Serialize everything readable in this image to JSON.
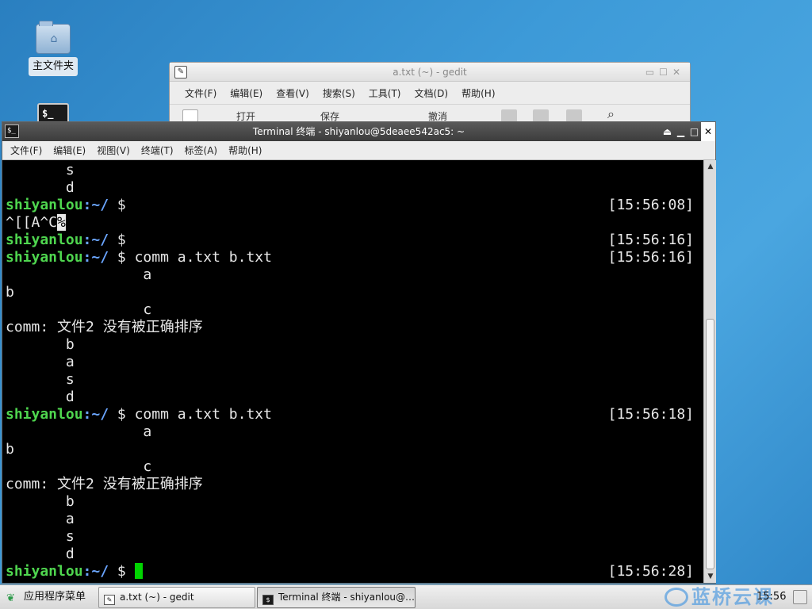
{
  "desktop": {
    "home_folder_label": "主文件夹",
    "terminal_icon_glyph": "$_"
  },
  "gedit": {
    "title": "a.txt (~) - gedit",
    "menu": [
      "文件(F)",
      "编辑(E)",
      "查看(V)",
      "搜索(S)",
      "工具(T)",
      "文档(D)",
      "帮助(H)"
    ],
    "toolbar": {
      "open_label": "打开",
      "save_label": "保存",
      "undo_label": "撤消"
    }
  },
  "terminal": {
    "title": "Terminal 终端 - shiyanlou@5deaee542ac5: ~",
    "menu": [
      "文件(F)",
      "编辑(E)",
      "视图(V)",
      "终端(T)",
      "标签(A)",
      "帮助(H)"
    ],
    "prompt_user": "shiyanlou",
    "prompt_path": ":~/",
    "prompt_symbol": " $",
    "lines": [
      {
        "kind": "out",
        "text": "       s"
      },
      {
        "kind": "out",
        "text": "       d"
      },
      {
        "kind": "prompt",
        "cmd": "",
        "ts": "[15:56:08]"
      },
      {
        "kind": "out_cursor",
        "text": "^[[A^C",
        "highlight": "%"
      },
      {
        "kind": "prompt",
        "cmd": "",
        "ts": "[15:56:16]"
      },
      {
        "kind": "prompt",
        "cmd": " comm a.txt b.txt",
        "ts": "[15:56:16]"
      },
      {
        "kind": "out",
        "text": "                a"
      },
      {
        "kind": "out",
        "text": "b"
      },
      {
        "kind": "out",
        "text": "                c"
      },
      {
        "kind": "out",
        "text": "comm: 文件2 没有被正确排序"
      },
      {
        "kind": "out",
        "text": "       b"
      },
      {
        "kind": "out",
        "text": "       a"
      },
      {
        "kind": "out",
        "text": "       s"
      },
      {
        "kind": "out",
        "text": "       d"
      },
      {
        "kind": "prompt",
        "cmd": " comm a.txt b.txt",
        "ts": "[15:56:18]"
      },
      {
        "kind": "out",
        "text": "                a"
      },
      {
        "kind": "out",
        "text": "b"
      },
      {
        "kind": "out",
        "text": "                c"
      },
      {
        "kind": "out",
        "text": "comm: 文件2 没有被正确排序"
      },
      {
        "kind": "out",
        "text": "       b"
      },
      {
        "kind": "out",
        "text": "       a"
      },
      {
        "kind": "out",
        "text": "       s"
      },
      {
        "kind": "out",
        "text": "       d"
      },
      {
        "kind": "prompt_active",
        "cmd": " ",
        "ts": "[15:56:28]"
      }
    ]
  },
  "taskbar": {
    "start_label": "应用程序菜单",
    "tasks": [
      {
        "label": "a.txt (~) - gedit",
        "active": false
      },
      {
        "label": "Terminal 终端 - shiyanlou@…",
        "active": true
      }
    ],
    "watermark": "蓝桥云课",
    "clock": "15:56"
  }
}
